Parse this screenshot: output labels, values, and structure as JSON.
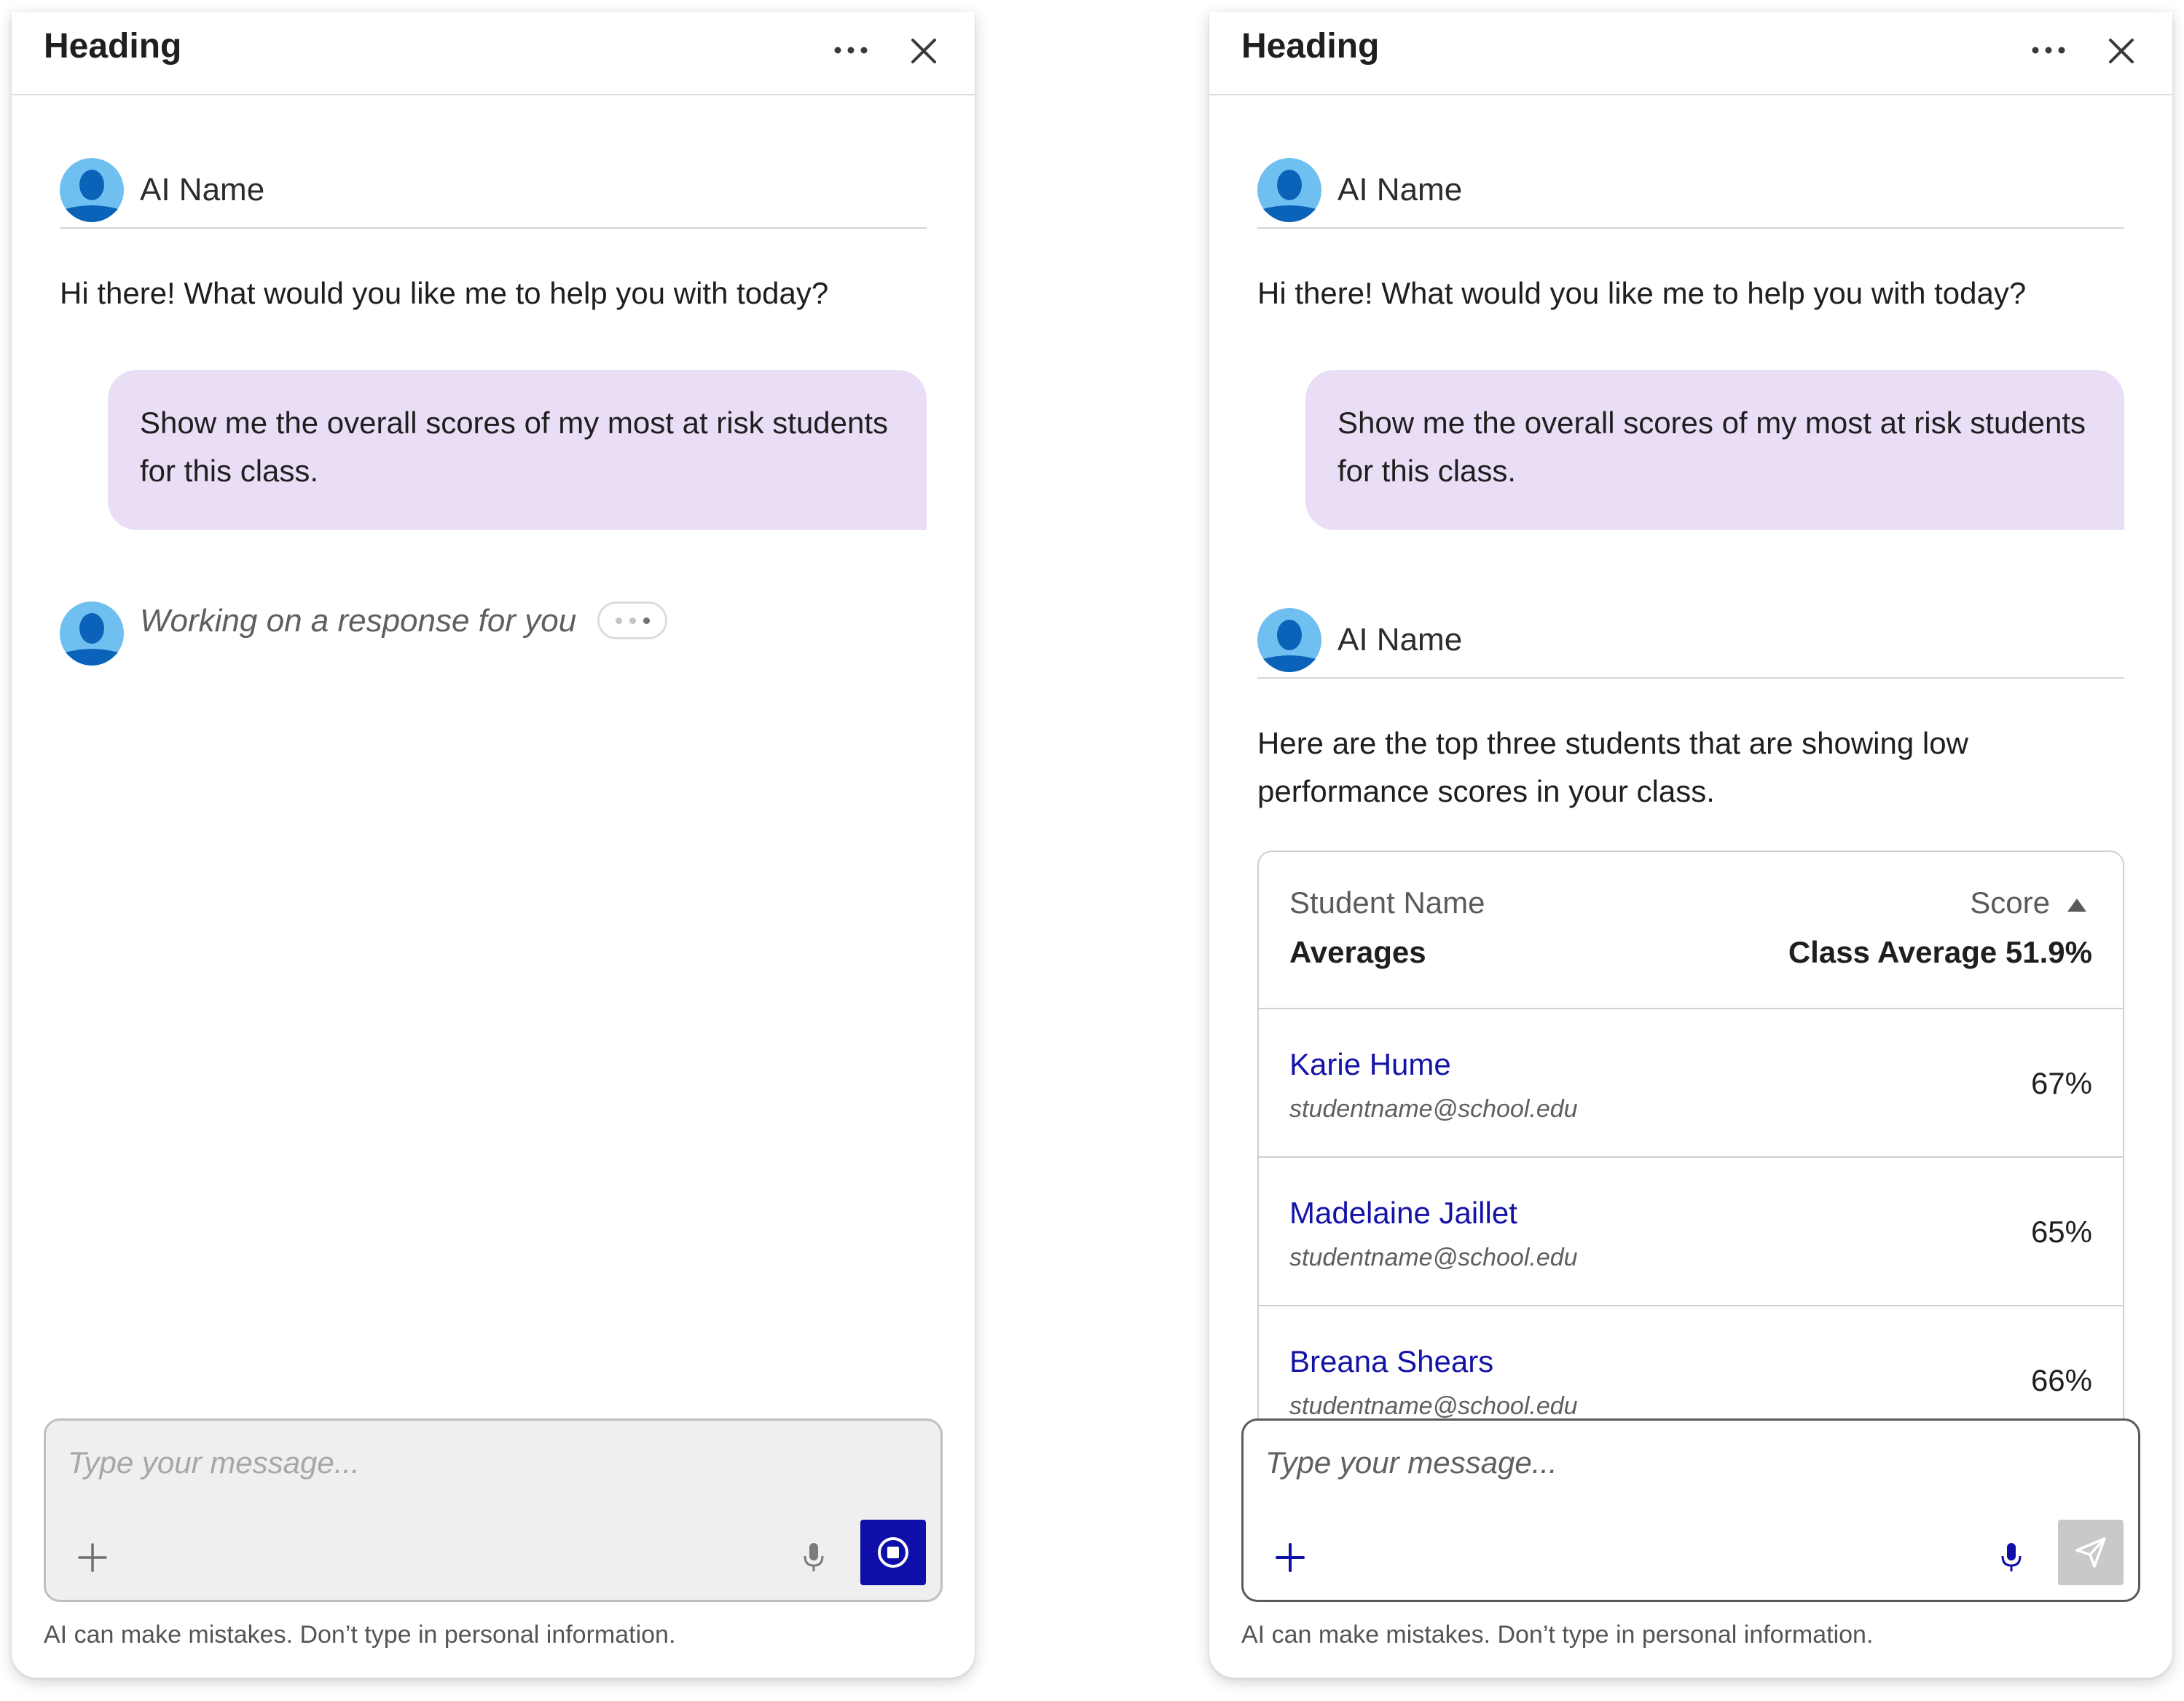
{
  "panels": [
    {
      "heading": "Heading",
      "ai_name": "AI Name",
      "greeting": "Hi there! What would you like me to help you with today?",
      "user_message": "Show me the overall scores of my most at risk students for this class.",
      "working_text": "Working on a response for you",
      "composer": {
        "placeholder": "Type your message...",
        "state": "generating"
      },
      "disclaimer": "AI can make mistakes. Don’t type in personal information."
    },
    {
      "heading": "Heading",
      "ai_name": "AI Name",
      "greeting": "Hi there! What would you like me to help you with today?",
      "user_message": "Show me the overall scores of my most at risk students for this class.",
      "response_ai_name": "AI Name",
      "response_text": "Here are the top three students that are showing low performance scores in your class.",
      "table": {
        "col_name": "Student Name",
        "col_score": "Score",
        "sort": "ascending",
        "averages_label": "Averages",
        "class_average": "Class Average 51.9%",
        "rows": [
          {
            "name": "Karie Hume",
            "email": "studentname@school.edu",
            "score": "67%"
          },
          {
            "name": "Madelaine Jaillet",
            "email": "studentname@school.edu",
            "score": "65%"
          },
          {
            "name": "Breana Shears",
            "email": "studentname@school.edu",
            "score": "66%"
          }
        ]
      },
      "composer": {
        "placeholder": "Type your message...",
        "state": "idle"
      },
      "disclaimer": "AI can make mistakes. Don’t type in personal information."
    }
  ],
  "colors": {
    "accent": "#0d0fa8",
    "link": "#1313a8",
    "user_bubble": "#e9def6",
    "avatar_bg": "#6fc0f0",
    "avatar_figure": "#0a63b8"
  },
  "icons": [
    "more-horizontal-icon",
    "close-icon",
    "avatar-icon",
    "plus-icon",
    "microphone-icon",
    "stop-icon",
    "send-icon",
    "sort-ascending-icon"
  ]
}
